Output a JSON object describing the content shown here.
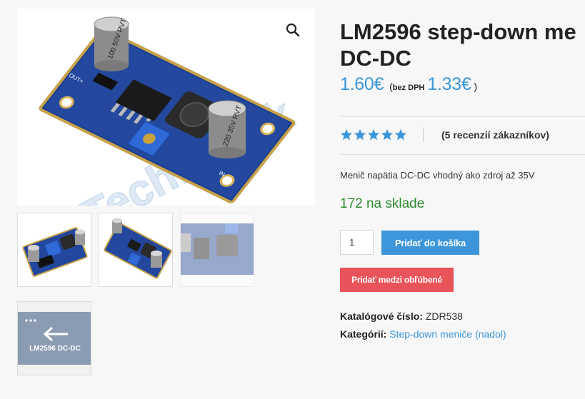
{
  "product": {
    "title_line1": "LM2596 step-down me",
    "title_line2": "DC-DC",
    "price": "1.60€",
    "price_open": "(",
    "vat_note": "bez DPH",
    "price_excl_vat": "1.33€",
    "price_close": ")",
    "rating": 5,
    "reviews": "(5 recenzií zákazníkov)",
    "description": "Menič napätia DC-DC vhodný ako zdroj až 35V",
    "stock": "172 na sklade",
    "quantity": "1",
    "add_to_cart": "Pridať do košíka",
    "add_to_wishlist": "Pridať medzi obľúbené",
    "sku_label": "Katalógové číslo:",
    "sku": "ZDR538",
    "category_label": "Kategórií:",
    "category": "Step-down meniče (nadol)"
  },
  "gallery": {
    "watermark": "Techfun.sk",
    "thumb_label": "LM2596 DC-DC",
    "cap1": "100 50V RVT",
    "cap2": "220 35V RVT",
    "pin_out_plus": "OUT+",
    "pin_in_minus": "IN-"
  },
  "colors": {
    "accent_blue": "#3c96d9",
    "wishlist_red": "#e85459",
    "stock_green": "#2e8b2e"
  }
}
